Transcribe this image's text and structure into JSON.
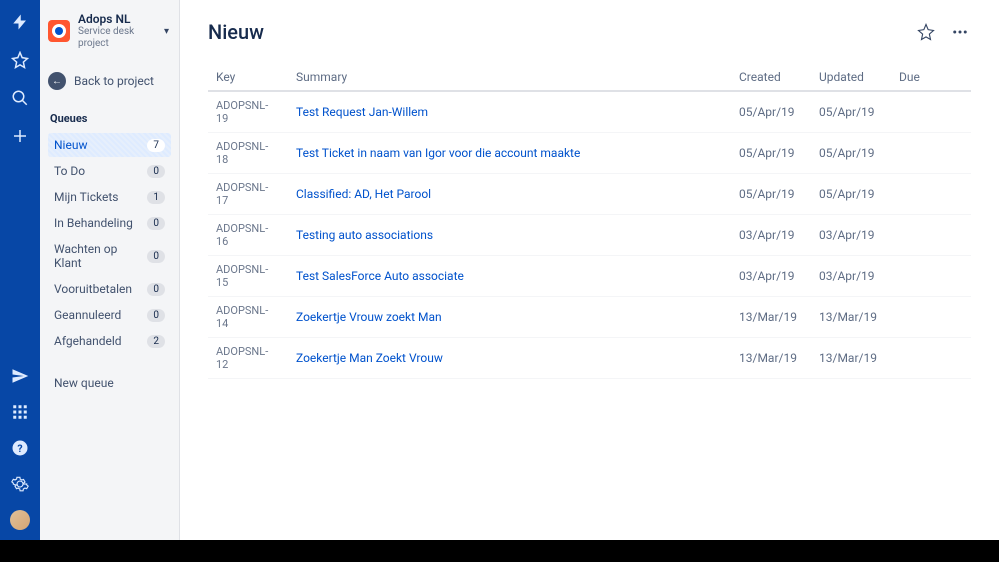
{
  "rail": {
    "icons_top": [
      "lightning-icon",
      "star-icon",
      "search-icon",
      "plus-icon"
    ],
    "icons_bottom": [
      "send-icon",
      "grid-icon",
      "help-icon",
      "gear-icon",
      "avatar"
    ]
  },
  "sidebar": {
    "project": {
      "name": "Adops NL",
      "type": "Service desk project"
    },
    "back_label": "Back to project",
    "section_title": "Queues",
    "queues": [
      {
        "label": "Nieuw",
        "count": "7",
        "selected": true
      },
      {
        "label": "To Do",
        "count": "0",
        "selected": false
      },
      {
        "label": "Mijn Tickets",
        "count": "1",
        "selected": false
      },
      {
        "label": "In Behandeling",
        "count": "0",
        "selected": false
      },
      {
        "label": "Wachten op Klant",
        "count": "0",
        "selected": false
      },
      {
        "label": "Vooruitbetalen",
        "count": "0",
        "selected": false
      },
      {
        "label": "Geannuleerd",
        "count": "0",
        "selected": false
      },
      {
        "label": "Afgehandeld",
        "count": "2",
        "selected": false
      }
    ],
    "new_queue_label": "New queue"
  },
  "main": {
    "title": "Nieuw",
    "columns": {
      "key": "Key",
      "summary": "Summary",
      "created": "Created",
      "updated": "Updated",
      "due": "Due"
    },
    "rows": [
      {
        "key": "ADOPSNL-19",
        "summary": "Test Request Jan-Willem",
        "created": "05/Apr/19",
        "updated": "05/Apr/19",
        "due": ""
      },
      {
        "key": "ADOPSNL-18",
        "summary": "Test Ticket in naam van Igor voor die account maakte",
        "created": "05/Apr/19",
        "updated": "05/Apr/19",
        "due": ""
      },
      {
        "key": "ADOPSNL-17",
        "summary": "Classified: AD, Het Parool",
        "created": "05/Apr/19",
        "updated": "05/Apr/19",
        "due": ""
      },
      {
        "key": "ADOPSNL-16",
        "summary": "Testing auto associations",
        "created": "03/Apr/19",
        "updated": "03/Apr/19",
        "due": ""
      },
      {
        "key": "ADOPSNL-15",
        "summary": "Test SalesForce Auto associate",
        "created": "03/Apr/19",
        "updated": "03/Apr/19",
        "due": ""
      },
      {
        "key": "ADOPSNL-14",
        "summary": "Zoekertje Vrouw zoekt Man",
        "created": "13/Mar/19",
        "updated": "13/Mar/19",
        "due": ""
      },
      {
        "key": "ADOPSNL-12",
        "summary": "Zoekertje Man Zoekt Vrouw",
        "created": "13/Mar/19",
        "updated": "13/Mar/19",
        "due": ""
      }
    ]
  }
}
